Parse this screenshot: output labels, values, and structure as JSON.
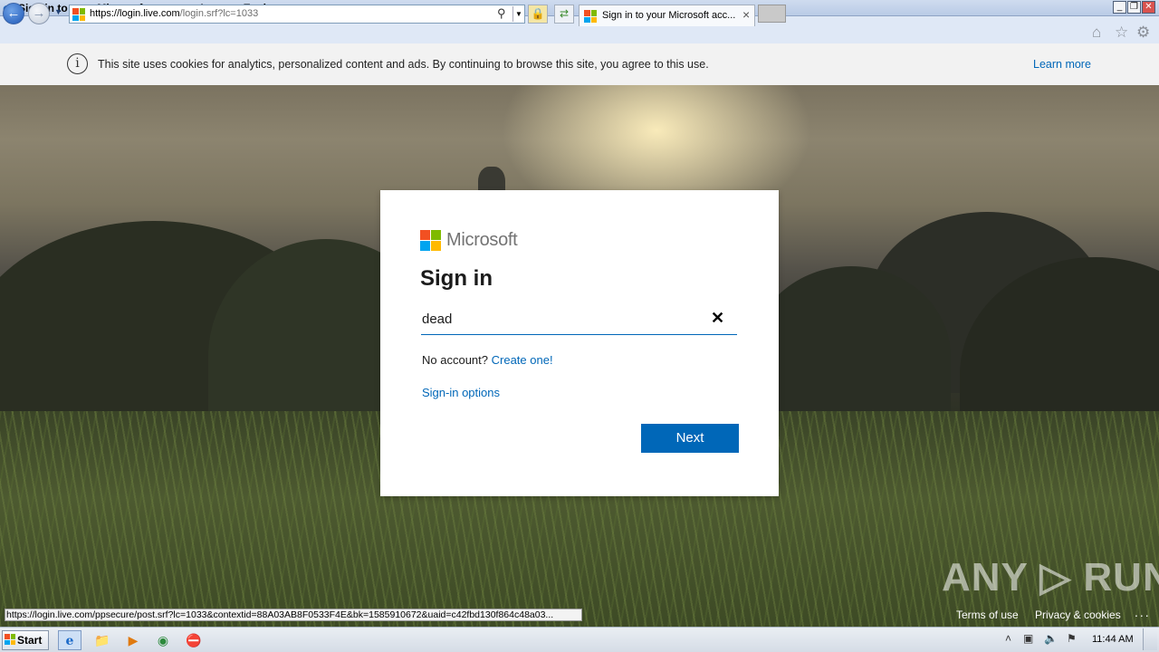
{
  "window": {
    "title": "Sign in to your Microsoft account - Internet Explorer",
    "controls": {
      "minimize": "_",
      "restore": "❐",
      "close": "✕"
    }
  },
  "browser": {
    "url_host": "https://login.live.com",
    "url_path": "/login.srf?lc=1033",
    "tab_title": "Sign in to your Microsoft acc...",
    "icons": {
      "back": "back-arrow-icon",
      "forward": "forward-arrow-icon",
      "search": "search-icon",
      "lock": "lock-icon",
      "refresh": "refresh-icon",
      "home": "home-icon",
      "favorites": "star-icon",
      "tools": "gear-icon"
    }
  },
  "cookie_banner": {
    "text": "This site uses cookies for analytics, personalized content and ads. By continuing to browse this site, you agree to this use.",
    "link": "Learn more"
  },
  "login": {
    "brand": "Microsoft",
    "title": "Sign in",
    "email_value": "dead",
    "no_account": "No account?",
    "create_link": "Create one!",
    "options_link": "Sign-in options",
    "next_button": "Next",
    "accent_color": "#0067b8"
  },
  "status_bar": {
    "url": "https://login.live.com/ppsecure/post.srf?lc=1033&contextid=88A03AB8F0533F4E&bk=1585910672&uaid=c42fbd130f864c48a03..."
  },
  "footer": {
    "terms": "Terms of use",
    "privacy": "Privacy & cookies",
    "more": "..."
  },
  "watermark": "ANY ▷ RUN",
  "taskbar": {
    "start": "Start",
    "clock": "11:44 AM"
  }
}
